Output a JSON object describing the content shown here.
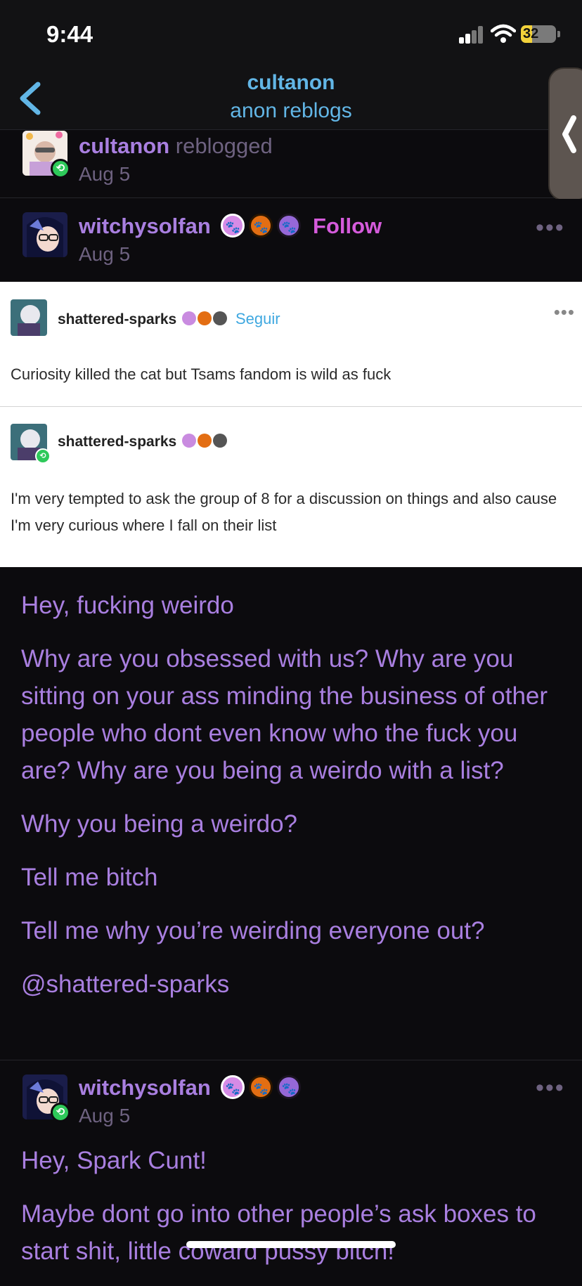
{
  "status_bar": {
    "time": "9:44",
    "battery": "32",
    "battery_level": 0.32
  },
  "nav": {
    "title": "cultanon",
    "subtitle": "anon reblogs"
  },
  "reblog_row": {
    "user": "cultanon",
    "action": "reblogged",
    "date": "Aug 5"
  },
  "post_header": {
    "user": "witchysolfan",
    "follow": "Follow",
    "date": "Aug 5",
    "more": "•••"
  },
  "screenshot": {
    "post1": {
      "user": "shattered-sparks",
      "follow": "Seguir",
      "text": "Curiosity killed the cat but Tsams fandom is wild as fuck",
      "more": "•••"
    },
    "post2": {
      "user": "shattered-sparks",
      "text": "I'm very tempted to ask the group of 8 for a discussion on things and also cause I'm very curious where I fall on their list"
    }
  },
  "body": [
    "Hey, fucking weirdo",
    "Why are you obsessed with us? Why are you sitting on your ass minding the business of other people who dont even know who the fuck you are? Why are you being a weirdo with a list?",
    "Why you being a weirdo?",
    "Tell me bitch",
    "Tell me why you’re weirding everyone out?",
    "@shattered-sparks"
  ],
  "reply_header": {
    "user": "witchysolfan",
    "date": "Aug 5",
    "more": "•••"
  },
  "reply_body": [
    "Hey, Spark Cunt!",
    "Maybe dont go into other people’s ask boxes to start shit, little coward pussy bitch!"
  ],
  "colors": {
    "accent_purple": "#a97fe0",
    "link_blue": "#62b6e6",
    "follow_pink": "#d55bdb",
    "reblog_green": "#2ec95a"
  }
}
